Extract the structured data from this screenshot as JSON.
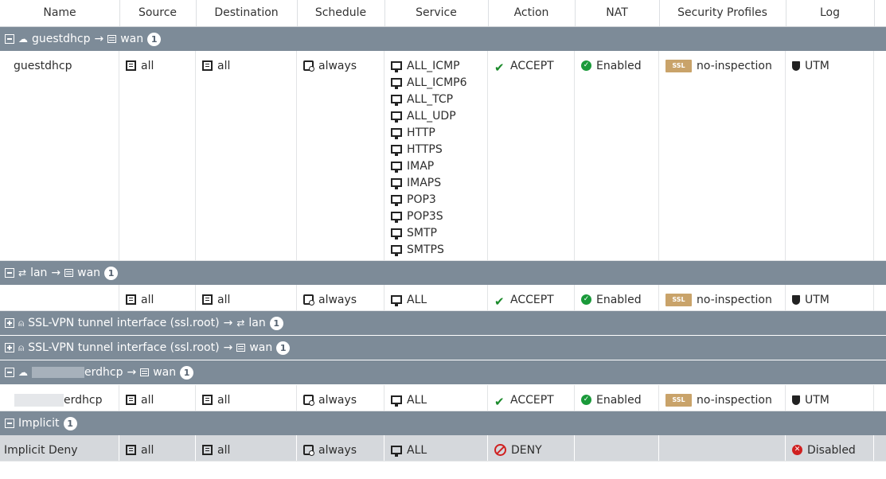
{
  "columns": [
    "Name",
    "Source",
    "Destination",
    "Schedule",
    "Service",
    "Action",
    "NAT",
    "Security Profiles",
    "Log"
  ],
  "groups": {
    "g1": {
      "from": "guestdhcp",
      "arrow": "→",
      "to": "wan",
      "count": "1"
    },
    "g2": {
      "from": "lan",
      "arrow": "→",
      "to": "wan",
      "count": "1"
    },
    "g3": {
      "from": "SSL-VPN tunnel interface (ssl.root)",
      "arrow": "→",
      "to": "lan",
      "count": "1"
    },
    "g4": {
      "from": "SSL-VPN tunnel interface (ssl.root)",
      "arrow": "→",
      "to": "wan",
      "count": "1"
    },
    "g5": {
      "from": "erdhcp",
      "arrow": "→",
      "to": "wan",
      "count": "1"
    },
    "g6": {
      "from": "Implicit",
      "count": "1"
    }
  },
  "rows": {
    "r1": {
      "name": "guestdhcp",
      "source": "all",
      "destination": "all",
      "schedule": "always",
      "services": [
        "ALL_ICMP",
        "ALL_ICMP6",
        "ALL_TCP",
        "ALL_UDP",
        "HTTP",
        "HTTPS",
        "IMAP",
        "IMAPS",
        "POP3",
        "POP3S",
        "SMTP",
        "SMTPS"
      ],
      "action": "ACCEPT",
      "nat": "Enabled",
      "ssl_badge": "SSL",
      "profile": "no-inspection",
      "log": "UTM"
    },
    "r2": {
      "name": "",
      "source": "all",
      "destination": "all",
      "schedule": "always",
      "service": "ALL",
      "action": "ACCEPT",
      "nat": "Enabled",
      "ssl_badge": "SSL",
      "profile": "no-inspection",
      "log": "UTM"
    },
    "r3": {
      "name": "erdhcp",
      "source": "all",
      "destination": "all",
      "schedule": "always",
      "service": "ALL",
      "action": "ACCEPT",
      "nat": "Enabled",
      "ssl_badge": "SSL",
      "profile": "no-inspection",
      "log": "UTM"
    },
    "r4": {
      "name": "Implicit Deny",
      "source": "all",
      "destination": "all",
      "schedule": "always",
      "service": "ALL",
      "action": "DENY",
      "log": "Disabled"
    }
  },
  "colors": {
    "group_bg": "#7d8b98",
    "accept": "#1a8a2a",
    "deny": "#d02020",
    "ssl_badge": "#c9a36a"
  }
}
